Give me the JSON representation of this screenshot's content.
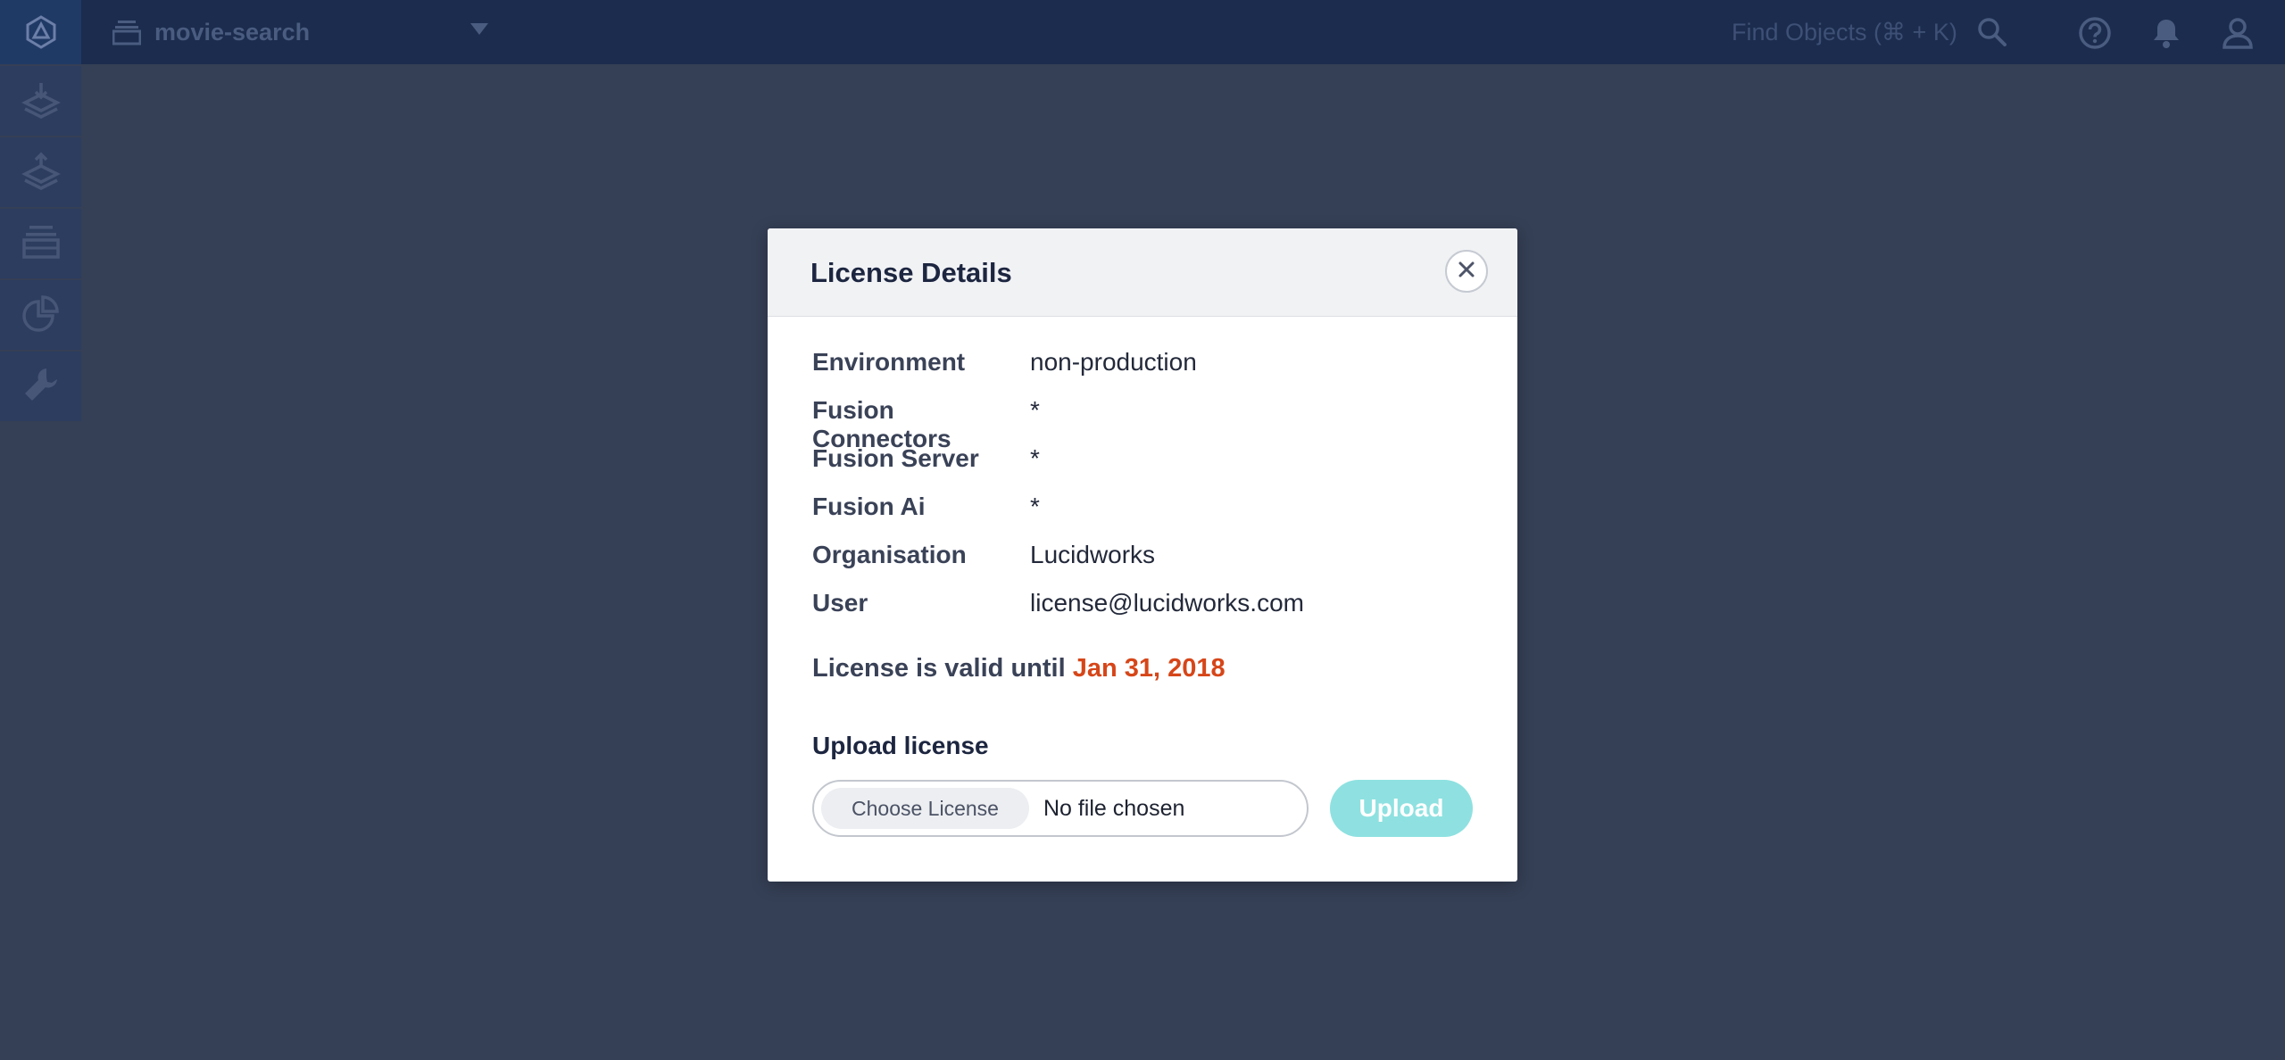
{
  "header": {
    "app_name": "movie-search",
    "find_label": "Find Objects (⌘ + K)"
  },
  "icons": {
    "logo": "fusion-logo-icon",
    "app": "collection-stack-icon",
    "caret": "caret-down-icon",
    "search": "search-icon",
    "help": "help-circle-icon",
    "notifications": "bell-icon",
    "user": "user-icon",
    "sidebar": [
      "index-workbench-icon",
      "query-workbench-icon",
      "collections-icon",
      "analytics-icon",
      "system-wrench-icon"
    ]
  },
  "modal": {
    "title": "License Details",
    "details": [
      {
        "label": "Environment",
        "value": "non-production"
      },
      {
        "label": "Fusion Connectors",
        "value": "*"
      },
      {
        "label": "Fusion Server",
        "value": "*"
      },
      {
        "label": "Fusion Ai",
        "value": "*"
      },
      {
        "label": "Organisation",
        "value": "Lucidworks"
      },
      {
        "label": "User",
        "value": "license@lucidworks.com"
      }
    ],
    "valid_prefix": "License is valid until",
    "valid_date": "Jan 31, 2018",
    "upload_title": "Upload license",
    "choose_label": "Choose License",
    "file_status": "No file chosen",
    "upload_label": "Upload"
  },
  "colors": {
    "topbar": "#1b2c4e",
    "sidebar_item": "#233d6a",
    "date_accent": "#d64619",
    "upload_button": "#8ee1e0"
  }
}
